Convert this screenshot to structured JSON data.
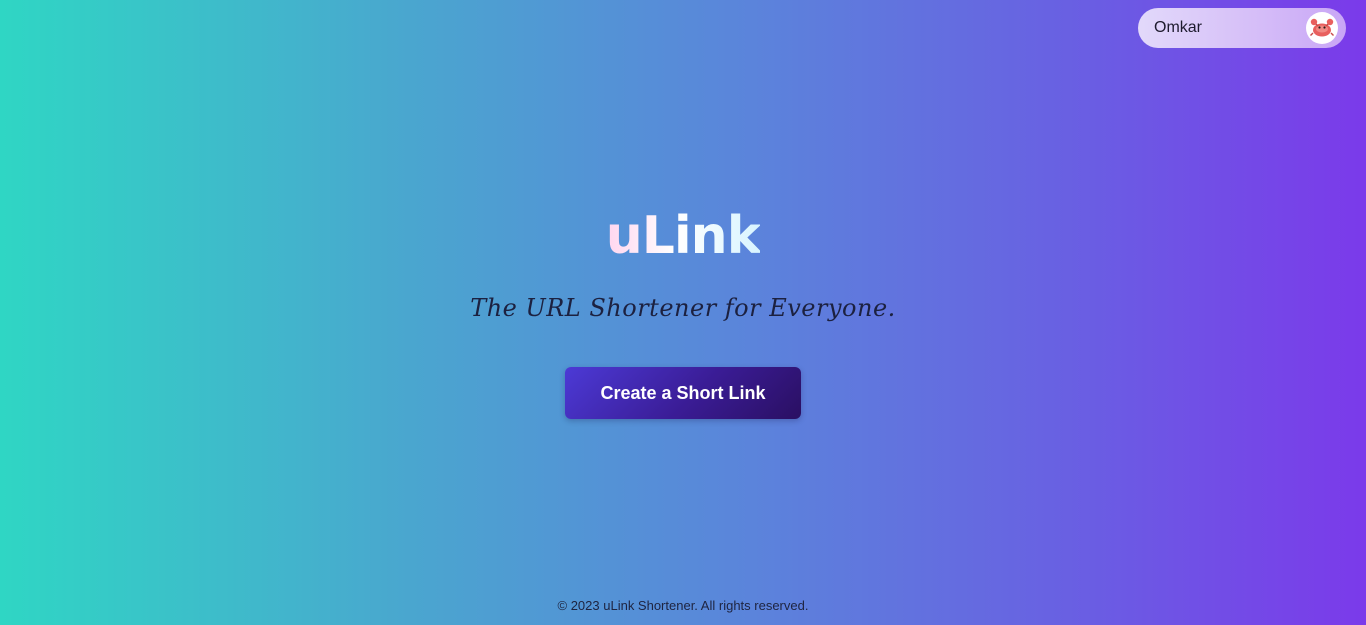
{
  "header": {
    "user_name": "Omkar",
    "avatar_icon": "crab-avatar-icon"
  },
  "hero": {
    "logo_text": "uLink",
    "tagline": "The URL Shortener for Everyone.",
    "cta_label": "Create a Short Link"
  },
  "footer": {
    "copyright": "© 2023 uLink Shortener. All rights reserved."
  },
  "colors": {
    "gradient_start": "#2fd6c4",
    "gradient_end": "#7b3aea",
    "button_bg": "#3a1c95",
    "button_text": "#ffffff"
  }
}
